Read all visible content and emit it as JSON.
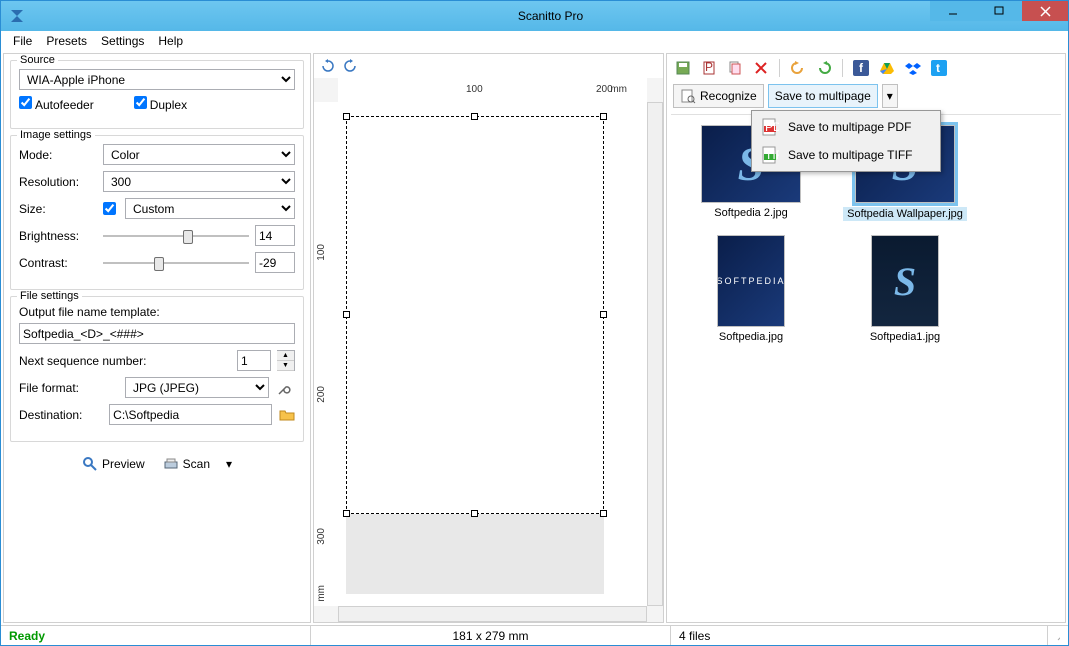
{
  "app": {
    "title": "Scanitto Pro"
  },
  "menu": {
    "file": "File",
    "presets": "Presets",
    "settings": "Settings",
    "help": "Help"
  },
  "source": {
    "legend": "Source",
    "device": "WIA-Apple iPhone",
    "autofeeder": "Autofeeder",
    "duplex": "Duplex"
  },
  "image": {
    "legend": "Image settings",
    "mode_label": "Mode:",
    "mode": "Color",
    "res_label": "Resolution:",
    "res": "300",
    "size_label": "Size:",
    "size": "Custom",
    "bright_label": "Brightness:",
    "bright": "14",
    "contrast_label": "Contrast:",
    "contrast": "-29"
  },
  "file": {
    "legend": "File settings",
    "tmpl_label": "Output file name template:",
    "tmpl": "Softpedia_<D>_<###>",
    "seq_label": "Next sequence number:",
    "seq": "1",
    "fmt_label": "File format:",
    "fmt": "JPG (JPEG)",
    "dest_label": "Destination:",
    "dest": "C:\\Softpedia"
  },
  "buttons": {
    "preview": "Preview",
    "scan": "Scan"
  },
  "ruler": {
    "h100": "100",
    "h200": "200",
    "unit": "mm",
    "v100": "100",
    "v200": "200",
    "v300": "300"
  },
  "right": {
    "recognize": "Recognize",
    "save_multi": "Save to multipage",
    "menu_pdf": "Save to multipage PDF",
    "menu_tiff": "Save to multipage TIFF"
  },
  "thumbs": [
    {
      "cap": "Softpedia 2.jpg"
    },
    {
      "cap": "Softpedia Wallpaper.jpg"
    },
    {
      "cap": "Softpedia.jpg"
    },
    {
      "cap": "Softpedia1.jpg"
    }
  ],
  "status": {
    "ready": "Ready",
    "dims": "181 x 279 mm",
    "count": "4 files"
  }
}
